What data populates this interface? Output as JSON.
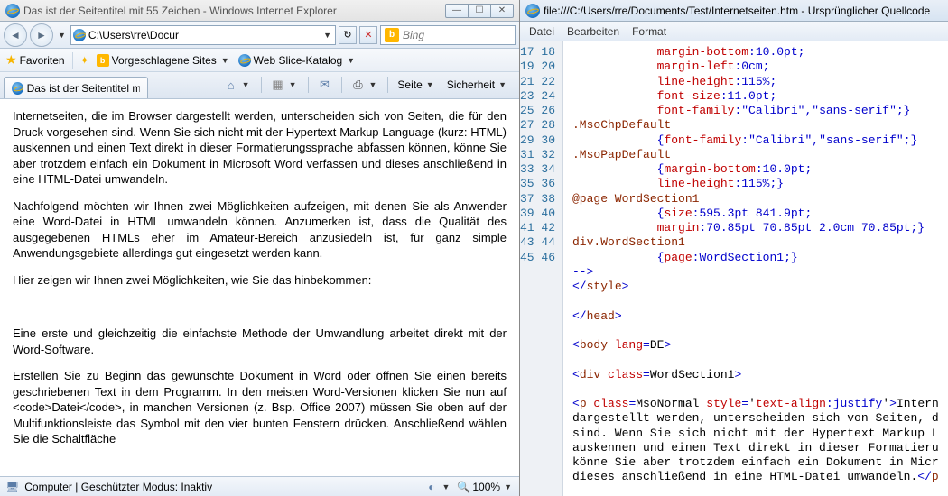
{
  "left": {
    "title": "Das ist der Seitentitel mit 55 Zeichen - Windows Internet Explorer",
    "address": "C:\\Users\\rre\\Docur",
    "search_placeholder": "Bing",
    "favorites_label": "Favoriten",
    "suggested": "Vorgeschlagene Sites",
    "webslice": "Web Slice-Katalog",
    "tab_label": "Das ist der Seitentitel mi...",
    "cmd_seite": "Seite",
    "cmd_sicherheit": "Sicherheit",
    "paragraphs": [
      "Internetseiten, die im Browser dargestellt werden, unterscheiden sich von Seiten, die für den Druck vorgesehen sind. Wenn Sie sich nicht mit der Hypertext Markup Language (kurz: HTML) auskennen und einen Text direkt in dieser Formatierungssprache abfassen können, könne Sie aber trotzdem einfach ein Dokument in Microsoft Word verfassen und dieses anschließend in eine HTML-Datei umwandeln.",
      "Nachfolgend möchten wir Ihnen zwei Möglichkeiten aufzeigen, mit denen Sie als Anwender eine Word-Datei in HTML umwandeln können. Anzumerken ist, dass die Qualität des ausgegebenen HTMLs eher im Amateur-Bereich anzusiedeln ist, für ganz simple Anwendungsgebiete allerdings gut eingesetzt werden kann.",
      "Hier zeigen wir Ihnen zwei Möglichkeiten, wie Sie das hinbekommen:",
      "",
      "Eine erste und gleichzeitig die einfachste Methode der Umwandlung arbeitet direkt mit der Word-Software.",
      "Erstellen Sie zu Beginn das gewünschte Dokument in Word oder öffnen Sie einen bereits geschriebenen Text in dem Programm. In den meisten Word-Versionen klicken Sie nun auf <code>Datei</code>, in manchen Versionen (z. Bsp. Office 2007) müssen Sie oben auf der Multifunktionsleiste das Symbol mit den vier bunten Fenstern drücken. Anschließend wählen Sie die Schaltfläche"
    ],
    "status_computer": "Computer | Geschützter Modus: Inaktiv",
    "zoom": "100%"
  },
  "right": {
    "title": "file:///C:/Users/rre/Documents/Test/Internetseiten.htm - Ursprünglicher Quellcode",
    "menu": {
      "datei": "Datei",
      "bearbeiten": "Bearbeiten",
      "format": "Format"
    },
    "line_start": 17,
    "line_end": 46,
    "code_lines": [
      {
        "indent": 12,
        "parts": [
          {
            "t": "margin-bottom",
            "c": "red"
          },
          {
            "t": ":10.0pt;",
            "c": "blue"
          }
        ]
      },
      {
        "indent": 12,
        "parts": [
          {
            "t": "margin-left",
            "c": "red"
          },
          {
            "t": ":0cm;",
            "c": "blue"
          }
        ]
      },
      {
        "indent": 12,
        "parts": [
          {
            "t": "line-height",
            "c": "red"
          },
          {
            "t": ":115%;",
            "c": "blue"
          }
        ]
      },
      {
        "indent": 12,
        "parts": [
          {
            "t": "font-size",
            "c": "red"
          },
          {
            "t": ":11.0pt;",
            "c": "blue"
          }
        ]
      },
      {
        "indent": 12,
        "parts": [
          {
            "t": "font-family",
            "c": "red"
          },
          {
            "t": ":\"Calibri\",\"sans-serif\";}",
            "c": "blue"
          }
        ]
      },
      {
        "indent": 0,
        "parts": [
          {
            "t": ".MsoChpDefault",
            "c": "brown"
          }
        ]
      },
      {
        "indent": 12,
        "parts": [
          {
            "t": "{",
            "c": "blue"
          },
          {
            "t": "font-family",
            "c": "red"
          },
          {
            "t": ":\"Calibri\",\"sans-serif\";}",
            "c": "blue"
          }
        ]
      },
      {
        "indent": 0,
        "parts": [
          {
            "t": ".MsoPapDefault",
            "c": "brown"
          }
        ]
      },
      {
        "indent": 12,
        "parts": [
          {
            "t": "{",
            "c": "blue"
          },
          {
            "t": "margin-bottom",
            "c": "red"
          },
          {
            "t": ":10.0pt;",
            "c": "blue"
          }
        ]
      },
      {
        "indent": 12,
        "parts": [
          {
            "t": "line-height",
            "c": "red"
          },
          {
            "t": ":115%;}",
            "c": "blue"
          }
        ]
      },
      {
        "indent": 0,
        "parts": [
          {
            "t": "@page WordSection1",
            "c": "brown"
          }
        ]
      },
      {
        "indent": 12,
        "parts": [
          {
            "t": "{",
            "c": "blue"
          },
          {
            "t": "size",
            "c": "red"
          },
          {
            "t": ":595.3pt 841.9pt;",
            "c": "blue"
          }
        ]
      },
      {
        "indent": 12,
        "parts": [
          {
            "t": "margin",
            "c": "red"
          },
          {
            "t": ":70.85pt 70.85pt 2.0cm 70.85pt;}",
            "c": "blue"
          }
        ]
      },
      {
        "indent": 0,
        "parts": [
          {
            "t": "div.WordSection1",
            "c": "brown"
          }
        ]
      },
      {
        "indent": 12,
        "parts": [
          {
            "t": "{",
            "c": "blue"
          },
          {
            "t": "page",
            "c": "red"
          },
          {
            "t": ":WordSection1;}",
            "c": "blue"
          }
        ]
      },
      {
        "indent": 0,
        "parts": [
          {
            "t": "-->",
            "c": "blue"
          }
        ]
      },
      {
        "indent": 0,
        "parts": [
          {
            "t": "</",
            "c": "blue"
          },
          {
            "t": "style",
            "c": "brown"
          },
          {
            "t": ">",
            "c": "blue"
          }
        ]
      },
      {
        "indent": 0,
        "parts": []
      },
      {
        "indent": 0,
        "parts": [
          {
            "t": "</",
            "c": "blue"
          },
          {
            "t": "head",
            "c": "brown"
          },
          {
            "t": ">",
            "c": "blue"
          }
        ]
      },
      {
        "indent": 0,
        "parts": []
      },
      {
        "indent": 0,
        "parts": [
          {
            "t": "<",
            "c": "blue"
          },
          {
            "t": "body ",
            "c": "brown"
          },
          {
            "t": "lang",
            "c": "red"
          },
          {
            "t": "=",
            "c": "blue"
          },
          {
            "t": "DE",
            "c": "black"
          },
          {
            "t": ">",
            "c": "blue"
          }
        ]
      },
      {
        "indent": 0,
        "parts": []
      },
      {
        "indent": 0,
        "parts": [
          {
            "t": "<",
            "c": "blue"
          },
          {
            "t": "div ",
            "c": "brown"
          },
          {
            "t": "class",
            "c": "red"
          },
          {
            "t": "=",
            "c": "blue"
          },
          {
            "t": "WordSection1",
            "c": "black"
          },
          {
            "t": ">",
            "c": "blue"
          }
        ]
      },
      {
        "indent": 0,
        "parts": []
      },
      {
        "indent": 0,
        "parts": [
          {
            "t": "<",
            "c": "blue"
          },
          {
            "t": "p ",
            "c": "brown"
          },
          {
            "t": "class",
            "c": "red"
          },
          {
            "t": "=",
            "c": "blue"
          },
          {
            "t": "MsoNormal ",
            "c": "black"
          },
          {
            "t": "style",
            "c": "red"
          },
          {
            "t": "=",
            "c": "blue"
          },
          {
            "t": "'",
            "c": "black"
          },
          {
            "t": "text-align",
            "c": "red"
          },
          {
            "t": ":justify",
            "c": "blue"
          },
          {
            "t": "'",
            "c": "black"
          },
          {
            "t": ">",
            "c": "blue"
          },
          {
            "t": "Intern",
            "c": "black"
          }
        ]
      },
      {
        "indent": 0,
        "parts": [
          {
            "t": "dargestellt werden, unterscheiden sich von Seiten, d",
            "c": "black"
          }
        ]
      },
      {
        "indent": 0,
        "parts": [
          {
            "t": "sind. Wenn Sie sich nicht mit der Hypertext Markup L",
            "c": "black"
          }
        ]
      },
      {
        "indent": 0,
        "parts": [
          {
            "t": "auskennen und einen Text direkt in dieser Formatieru",
            "c": "black"
          }
        ]
      },
      {
        "indent": 0,
        "parts": [
          {
            "t": "könne Sie aber trotzdem einfach ein Dokument in Micr",
            "c": "black"
          }
        ]
      },
      {
        "indent": 0,
        "parts": [
          {
            "t": "dieses anschließend in eine HTML-Datei umwandeln.",
            "c": "black"
          },
          {
            "t": "</",
            "c": "blue"
          },
          {
            "t": "p",
            "c": "brown"
          }
        ]
      }
    ]
  }
}
